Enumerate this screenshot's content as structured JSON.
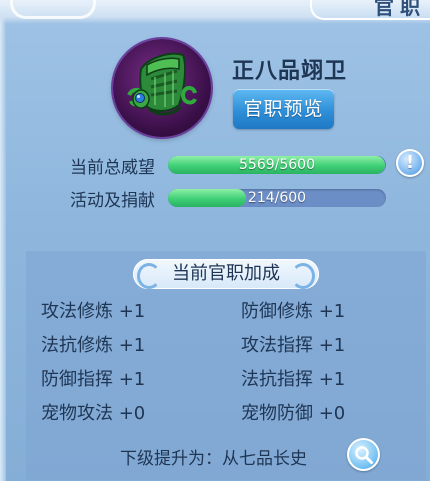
{
  "header": {
    "title": "官职"
  },
  "rank": {
    "name": "正八品翊卫",
    "preview_button": "官职预览",
    "emblem_icon": "official-hat-icon"
  },
  "stats": {
    "prestige_label": "当前总威望",
    "prestige_current": 5569,
    "prestige_max": 5600,
    "prestige_text": "5569/5600",
    "activity_label": "活动及捐献",
    "activity_current": 214,
    "activity_max": 600,
    "activity_text": "214/600",
    "info_icon": "exclamation-icon"
  },
  "bonus_panel": {
    "title": "当前官职加成",
    "items": [
      {
        "label": "攻法修炼 +1"
      },
      {
        "label": "防御修炼 +1"
      },
      {
        "label": "法抗修炼 +1"
      },
      {
        "label": "攻法指挥 +1"
      },
      {
        "label": "防御指挥 +1"
      },
      {
        "label": "法抗指挥 +1"
      },
      {
        "label": "宠物攻法 +0"
      },
      {
        "label": "宠物防御 +0"
      }
    ],
    "next_promotion": "下级提升为：从七品长史",
    "search_icon": "magnifier-icon"
  },
  "colors": {
    "background": "#8fb7dd",
    "progress_fill": "#3fcf76",
    "progress_track": "#6c8ec7",
    "button": "#2f8fd8",
    "text": "#1f3554"
  }
}
